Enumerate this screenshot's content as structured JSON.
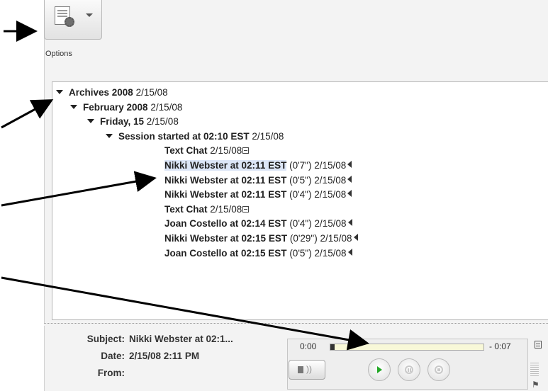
{
  "toolbar": {
    "options_label": "Options",
    "options_icon": "options-gear-icon"
  },
  "tree": [
    {
      "title": "Archives 2008",
      "date": "2/15/08",
      "expanded": true,
      "icon": "expand-triangle-icon"
    },
    {
      "title": "February 2008",
      "date": "2/15/08",
      "expanded": true,
      "icon": "expand-triangle-icon"
    },
    {
      "title": "Friday, 15",
      "date": "2/15/08",
      "expanded": true,
      "icon": "expand-triangle-icon"
    },
    {
      "title": "Session started at 02:10 EST",
      "date": "2/15/08",
      "expanded": true,
      "icon": "expand-triangle-icon"
    },
    {
      "title": "Text Chat",
      "date": "2/15/08",
      "icon": "text-chat-icon"
    },
    {
      "title": "Nikki Webster at 02:11 EST",
      "duration": "(0'7\")",
      "date": "2/15/08",
      "selected": true,
      "icon": "audio-icon"
    },
    {
      "title": "Nikki Webster at 02:11 EST",
      "duration": "(0'5\")",
      "date": "2/15/08",
      "icon": "audio-icon"
    },
    {
      "title": "Nikki Webster at 02:11 EST",
      "duration": "(0'4\")",
      "date": "2/15/08",
      "icon": "audio-icon"
    },
    {
      "title": "Text Chat",
      "date": "2/15/08",
      "icon": "text-chat-icon"
    },
    {
      "title": "Joan Costello at 02:14 EST",
      "duration": "(0'4\")",
      "date": "2/15/08",
      "icon": "audio-icon"
    },
    {
      "title": "Nikki Webster at 02:15 EST",
      "duration": "(0'29\")",
      "date": "2/15/08",
      "icon": "audio-icon"
    },
    {
      "title": "Joan Costello at 02:15 EST",
      "duration": "(0'5\")",
      "date": "2/15/08",
      "icon": "audio-icon"
    }
  ],
  "details": {
    "subject_label": "Subject:",
    "subject_value": "Nikki Webster at 02:1...",
    "date_label": "Date:",
    "date_value": "2/15/08 2:11 PM",
    "from_label": "From:",
    "from_value": ""
  },
  "player": {
    "elapsed": "0:00",
    "remaining": "- 0:07",
    "progress_fraction": 0.0,
    "colors": {
      "play": "#23a826",
      "track": "#f8f8d8"
    }
  },
  "colors": {
    "selection": "#dce6f7",
    "panel_bg": "#f3f3f3"
  }
}
